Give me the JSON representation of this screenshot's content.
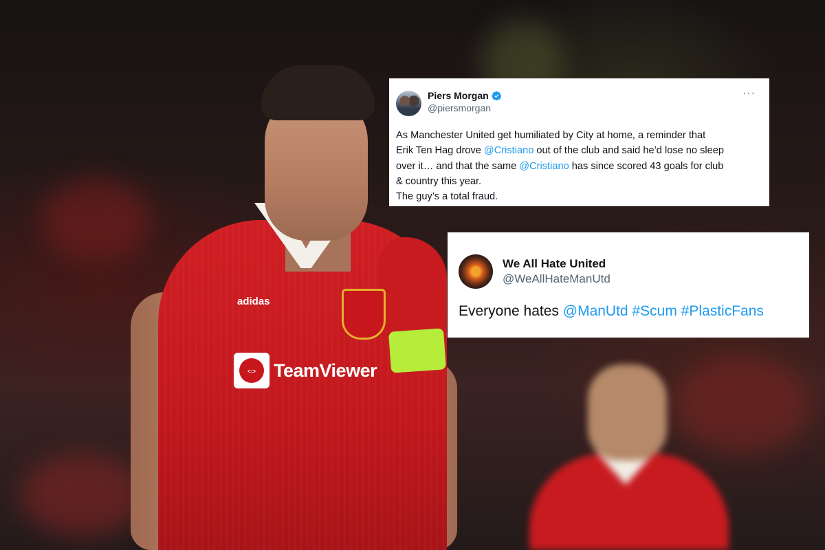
{
  "background": {
    "player_shirt": {
      "brand": "adidas",
      "sponsor": "TeamViewer",
      "sponsor_mark": "⇔"
    }
  },
  "tweets": [
    {
      "name": "Piers Morgan",
      "handle": "@piersmorgan",
      "verified": true,
      "more_label": "···",
      "body_lines": [
        [
          {
            "text": "As Manchester United get humiliated by City at home, a reminder that",
            "link": false
          }
        ],
        [
          {
            "text": "Erik Ten Hag drove ",
            "link": false
          },
          {
            "text": "@Cristiano",
            "link": true
          },
          {
            "text": " out of the club and said he’d lose no sleep",
            "link": false
          }
        ],
        [
          {
            "text": "over it… and that the same ",
            "link": false
          },
          {
            "text": "@Cristiano",
            "link": true
          },
          {
            "text": " has since scored 43 goals for club",
            "link": false
          }
        ],
        [
          {
            "text": "& country this year.",
            "link": false
          }
        ],
        [
          {
            "text": "The guy’s a total fraud.",
            "link": false
          }
        ]
      ]
    },
    {
      "name": "We All Hate United",
      "handle": "@WeAllHateManUtd",
      "verified": false,
      "body_parts": [
        {
          "text": "Everyone hates ",
          "link": false
        },
        {
          "text": "@ManUtd",
          "link": true
        },
        {
          "text": " ",
          "link": false
        },
        {
          "text": "#Scum",
          "link": true
        },
        {
          "text": " ",
          "link": false
        },
        {
          "text": "#PlasticFans",
          "link": true
        }
      ]
    }
  ],
  "colors": {
    "link": "#1d9bf0",
    "text": "#0f1419",
    "secondary": "#536471",
    "kit_red": "#c8171c"
  }
}
